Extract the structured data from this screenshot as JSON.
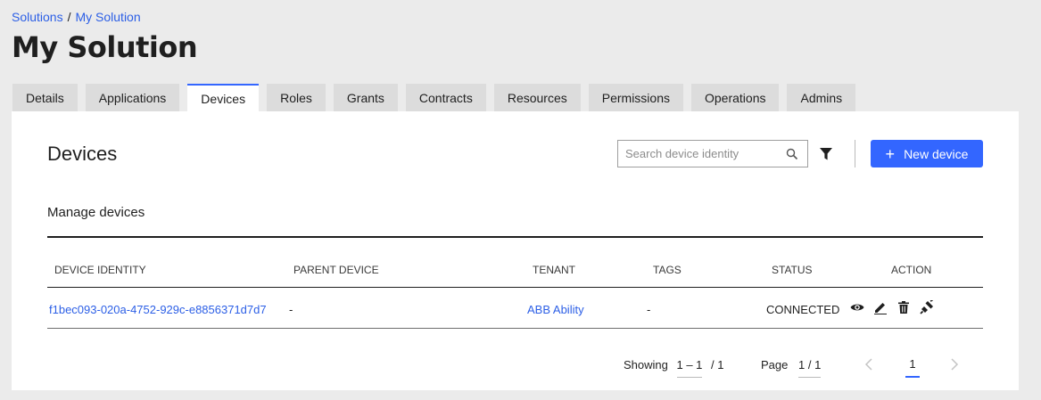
{
  "breadcrumb": {
    "root": "Solutions",
    "separator": "/",
    "current": "My Solution"
  },
  "page_title": "My Solution",
  "tabs": [
    {
      "label": "Details"
    },
    {
      "label": "Applications"
    },
    {
      "label": "Devices",
      "active": true
    },
    {
      "label": "Roles"
    },
    {
      "label": "Grants"
    },
    {
      "label": "Contracts"
    },
    {
      "label": "Resources"
    },
    {
      "label": "Permissions"
    },
    {
      "label": "Operations"
    },
    {
      "label": "Admins"
    }
  ],
  "section": {
    "title": "Devices",
    "subtitle": "Manage devices",
    "search_placeholder": "Search device identity",
    "search_value": "",
    "new_button_label": "New device"
  },
  "table": {
    "headers": [
      "DEVICE IDENTITY",
      "PARENT DEVICE",
      "TENANT",
      "TAGS",
      "STATUS",
      "ACTION"
    ],
    "rows": [
      {
        "device_identity": "f1bec093-020a-4752-929c-e8856371d7d7",
        "parent_device": "-",
        "tenant": "ABB Ability",
        "tags": "-",
        "status": "CONNECTED"
      }
    ]
  },
  "pagination": {
    "showing_label": "Showing",
    "showing_range": "1 – 1",
    "showing_total": "/ 1",
    "page_label": "Page",
    "page_value": "1 / 1",
    "current_page": "1"
  },
  "colors": {
    "accent": "#3366ff",
    "link": "#2c5fe6"
  },
  "icons": {
    "search": "search-icon",
    "filter": "filter-icon",
    "view": "eye-icon",
    "edit": "pencil-icon",
    "delete": "trash-icon",
    "connect": "plug-icon",
    "prev": "chevron-left-icon",
    "next": "chevron-right-icon"
  }
}
